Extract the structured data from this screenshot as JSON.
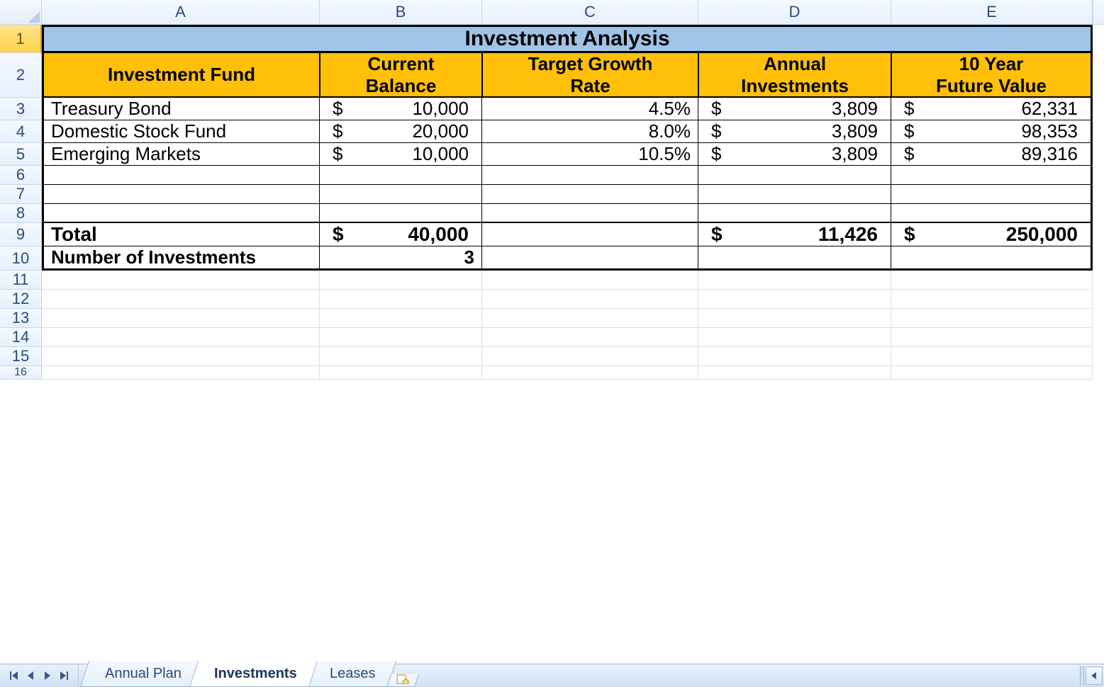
{
  "columns": [
    "A",
    "B",
    "C",
    "D",
    "E"
  ],
  "row_labels": [
    "1",
    "2",
    "3",
    "4",
    "5",
    "6",
    "7",
    "8",
    "9",
    "10",
    "11",
    "12",
    "13",
    "14",
    "15",
    "16"
  ],
  "selected_row_header": 1,
  "title": "Investment Analysis",
  "headers": {
    "a": "Investment Fund",
    "b": "Current\nBalance",
    "c": "Target Growth\nRate",
    "d": "Annual\nInvestments",
    "e": "10 Year\nFuture Value"
  },
  "rows": [
    {
      "fund": "Treasury Bond",
      "balance": "10,000",
      "rate": "4.5%",
      "annual": "3,809",
      "future": "62,331"
    },
    {
      "fund": "Domestic Stock Fund",
      "balance": "20,000",
      "rate": "8.0%",
      "annual": "3,809",
      "future": "98,353"
    },
    {
      "fund": "Emerging Markets",
      "balance": "10,000",
      "rate": "10.5%",
      "annual": "3,809",
      "future": "89,316"
    }
  ],
  "totals": {
    "label": "Total",
    "balance": "40,000",
    "annual": "11,426",
    "future": "250,000"
  },
  "count": {
    "label": "Number of Investments",
    "value": "3"
  },
  "money_symbol": "$",
  "tabs": {
    "items": [
      "Annual Plan",
      "Investments",
      "Leases"
    ],
    "active": 1
  },
  "chart_data": {
    "type": "table",
    "title": "Investment Analysis",
    "columns": [
      "Investment Fund",
      "Current Balance",
      "Target Growth Rate",
      "Annual Investments",
      "10 Year Future Value"
    ],
    "rows": [
      [
        "Treasury Bond",
        10000,
        0.045,
        3809,
        62331
      ],
      [
        "Domestic Stock Fund",
        20000,
        0.08,
        3809,
        98353
      ],
      [
        "Emerging Markets",
        10000,
        0.105,
        3809,
        89316
      ]
    ],
    "totals": {
      "Current Balance": 40000,
      "Annual Investments": 11426,
      "10 Year Future Value": 250000
    },
    "count": 3
  }
}
